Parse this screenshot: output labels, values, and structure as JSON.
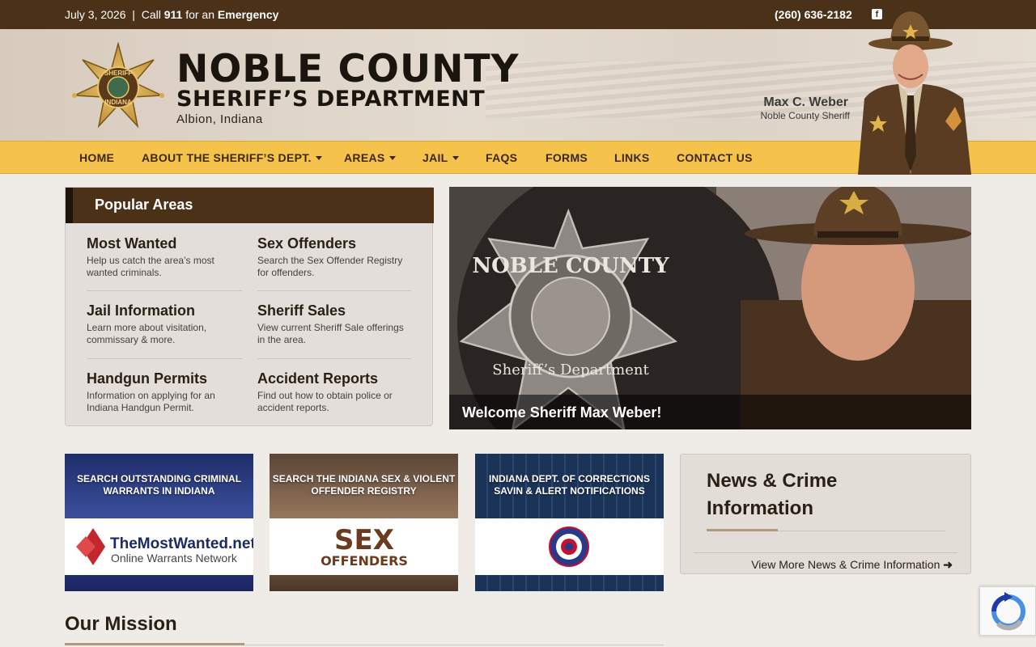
{
  "topbar": {
    "date": "July 3, 2026",
    "separator": "|",
    "call": "Call",
    "number": "911",
    "for_an": "for an",
    "emergency": "Emergency",
    "phone": "(260) 636-2182",
    "facebook_icon": "facebook-icon"
  },
  "header": {
    "title_line1": "NOBLE COUNTY",
    "title_line2": "SHERIFF’S DEPARTMENT",
    "location": "Albion, Indiana",
    "sheriff_name": "Max C. Weber",
    "sheriff_title": "Noble County Sheriff",
    "badge_text_top": "SHERIFF",
    "badge_text_bottom": "INDIANA"
  },
  "nav": {
    "items": [
      {
        "label": "HOME",
        "dropdown": false
      },
      {
        "label": "ABOUT THE SHERIFF’S DEPT.",
        "dropdown": true
      },
      {
        "label": "AREAS",
        "dropdown": true
      },
      {
        "label": "JAIL",
        "dropdown": true
      },
      {
        "label": "FAQS",
        "dropdown": false
      },
      {
        "label": "FORMS",
        "dropdown": false
      },
      {
        "label": "LINKS",
        "dropdown": false
      },
      {
        "label": "CONTACT US",
        "dropdown": false
      }
    ]
  },
  "popular": {
    "heading": "Popular Areas",
    "items": [
      {
        "title": "Most Wanted",
        "desc": "Help us catch the area’s most wanted criminals."
      },
      {
        "title": "Sex Offenders",
        "desc": "Search the Sex Offender Registry for offenders."
      },
      {
        "title": "Jail Information",
        "desc": "Learn more about visitation, commissary & more."
      },
      {
        "title": "Sheriff Sales",
        "desc": "View current Sheriff Sale offerings in the area."
      },
      {
        "title": "Handgun Permits",
        "desc": "Information on applying for an Indiana Handgun Permit."
      },
      {
        "title": "Accident Reports",
        "desc": "Find out how to obtain police or accident reports."
      }
    ]
  },
  "hero": {
    "caption": "Welcome Sheriff Max Weber!",
    "seal_top": "NOBLE COUNTY",
    "seal_bottom": "Sheriff’s Department"
  },
  "cards": [
    {
      "label": "SEARCH OUTSTANDING CRIMINAL WARRANTS IN INDIANA",
      "logo_main": "TheMostWanted.net",
      "logo_sub": "Online Warrants Network"
    },
    {
      "label": "SEARCH THE INDIANA SEX & VIOLENT OFFENDER REGISTRY",
      "logo_main": "SEX",
      "logo_sub": "OFFENDERS"
    },
    {
      "label": "INDIANA DEPT. OF CORRECTIONS SAVIN & ALERT NOTIFICATIONS",
      "logo_main": "",
      "logo_sub": ""
    }
  ],
  "news": {
    "title": "News & Crime Information",
    "more": "View More News & Crime Information"
  },
  "mission": {
    "title": "Our Mission"
  },
  "colors": {
    "brown": "#4b3118",
    "gold": "#f5c34c",
    "background": "#efebe7"
  }
}
